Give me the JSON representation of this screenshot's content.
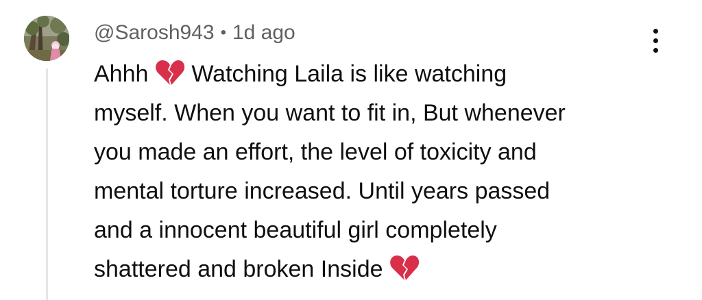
{
  "comment": {
    "author": "@Sarosh943",
    "separator": "•",
    "time": "1d ago",
    "avatar_icon": "profile-photo",
    "menu_icon": "more-vert-icon",
    "lines": [
      {
        "before": "Ahhh",
        "emoji": "broken-heart-icon",
        "after": "Watching Laila is like watching"
      },
      {
        "text": "myself. When you want to fit in, But whenever"
      },
      {
        "text": "you made an effort, the level of toxicity and"
      },
      {
        "text": "mental torture increased. Until years passed"
      },
      {
        "text": "and a innocent beautiful girl completely"
      },
      {
        "before": "shattered and broken Inside",
        "emoji": "broken-heart-icon"
      }
    ]
  },
  "colors": {
    "text": "#0f0f0f",
    "meta": "#606060",
    "thread_line": "#e5e5e5",
    "heart": "#d8304a"
  }
}
